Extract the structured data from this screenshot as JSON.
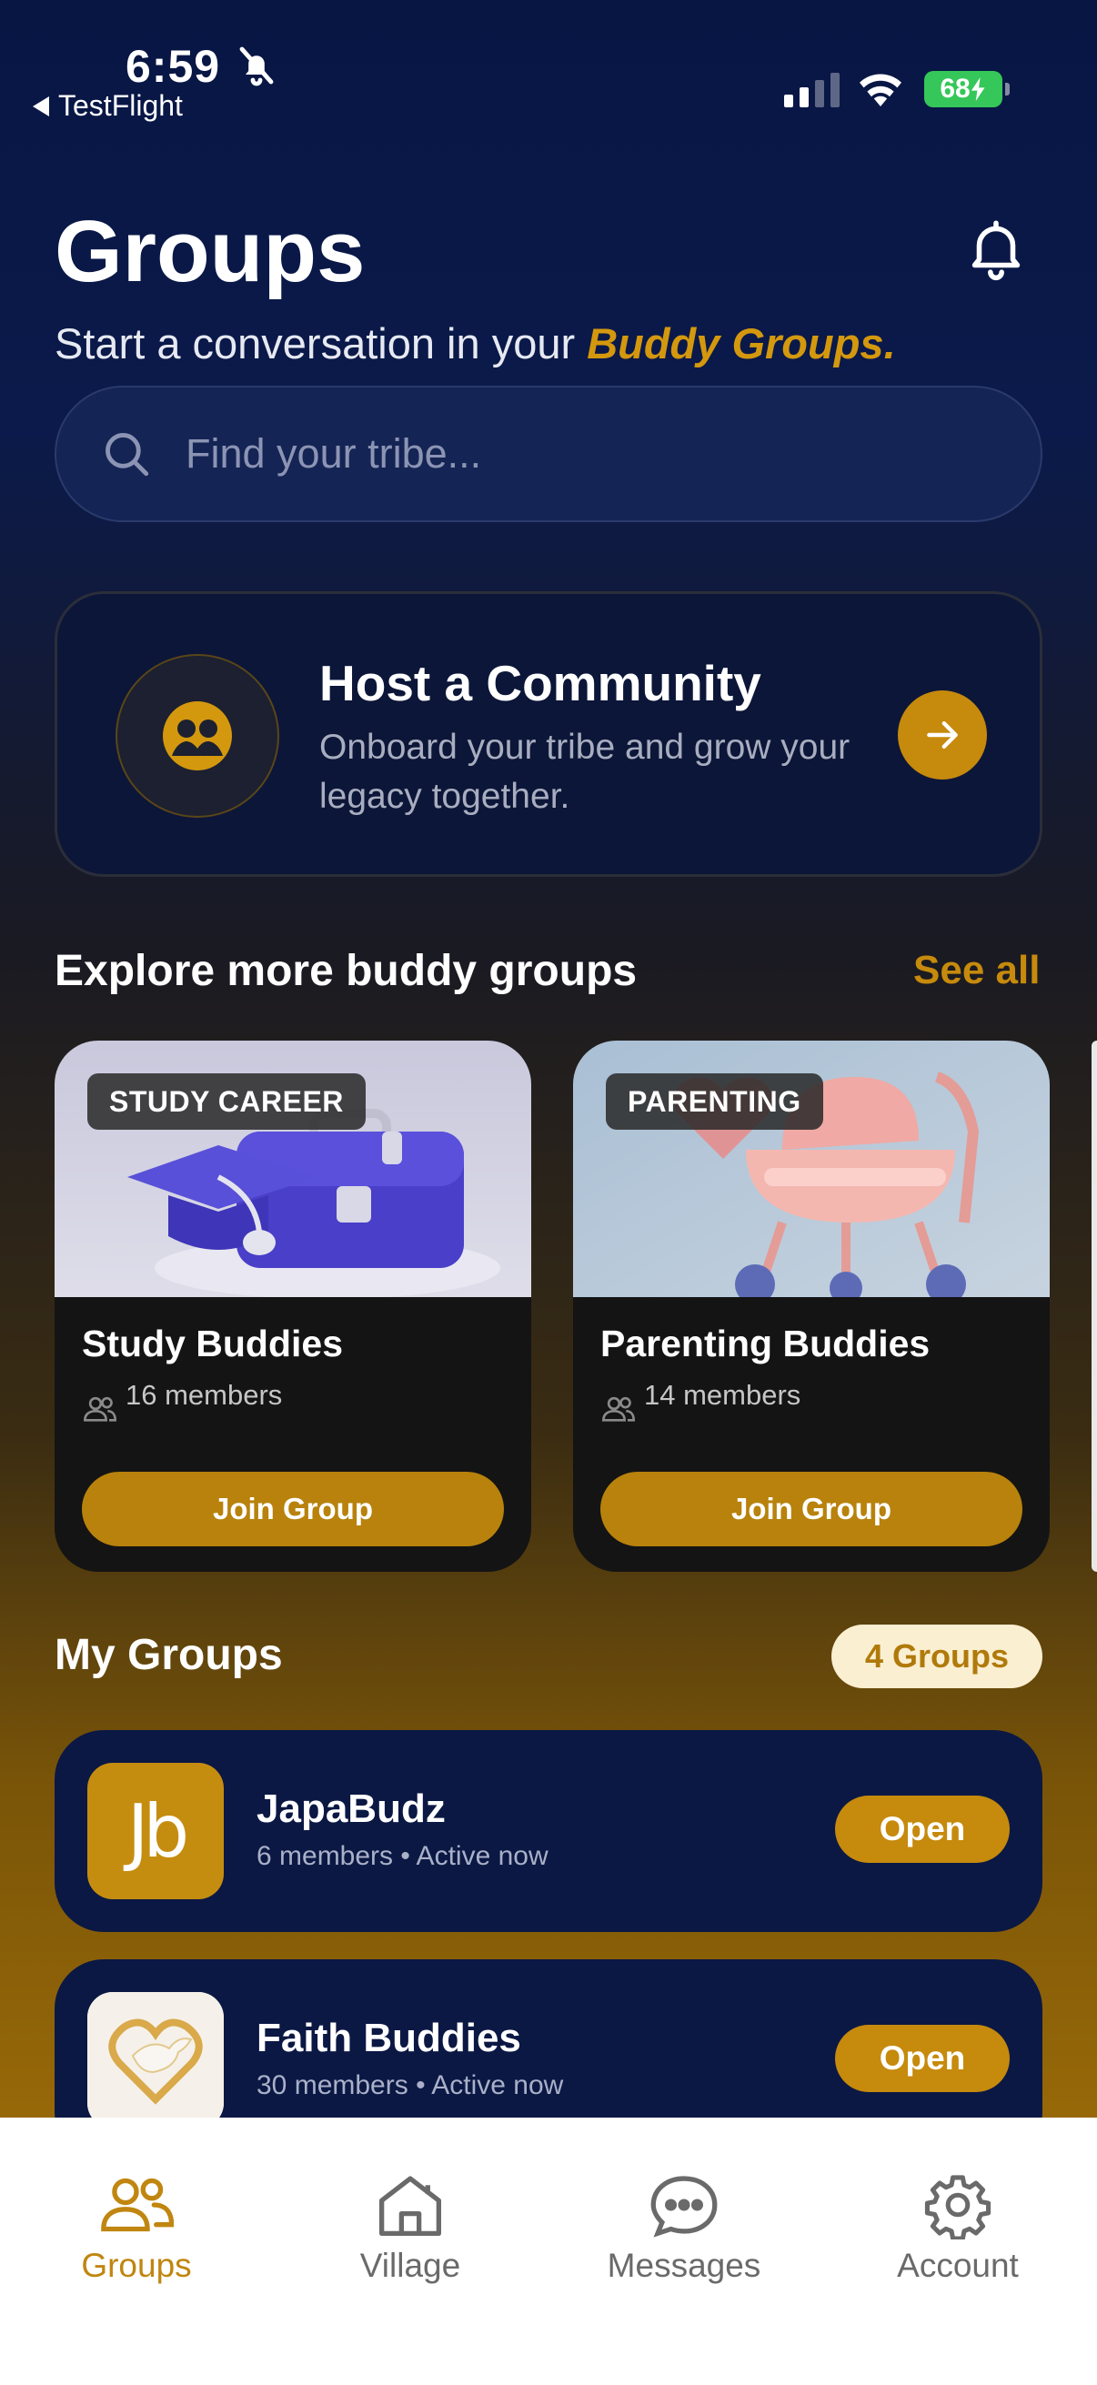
{
  "status_bar": {
    "time": "6:59",
    "back_app": "TestFlight",
    "battery": "68"
  },
  "header": {
    "title": "Groups",
    "subtitle_prefix": "Start a conversation in your ",
    "subtitle_highlight": "Buddy Groups."
  },
  "search": {
    "placeholder": "Find your tribe..."
  },
  "host_card": {
    "title": "Host a Community",
    "description": "Onboard your tribe and grow your legacy together."
  },
  "explore": {
    "title": "Explore more buddy groups",
    "see_all": "See all",
    "cards": [
      {
        "tag": "STUDY CAREER",
        "name": "Study Buddies",
        "members": "16 members",
        "button": "Join Group"
      },
      {
        "tag": "PARENTING",
        "name": "Parenting Buddies",
        "members": "14 members",
        "button": "Join Group"
      }
    ]
  },
  "my_groups": {
    "title": "My Groups",
    "count": "4 Groups",
    "items": [
      {
        "avatar_text": "Jb",
        "name": "JapaBudz",
        "meta": "6 members • Active now",
        "button": "Open"
      },
      {
        "name": "Faith Buddies",
        "meta": "30 members • Active now",
        "button": "Open"
      }
    ]
  },
  "tabbar": {
    "items": [
      {
        "label": "Groups",
        "icon": "groups-icon"
      },
      {
        "label": "Village",
        "icon": "house-icon"
      },
      {
        "label": "Messages",
        "icon": "chat-bubble-icon"
      },
      {
        "label": "Account",
        "icon": "gear-icon"
      }
    ]
  },
  "colors": {
    "accent": "#c68a0c",
    "background_top": "#081644",
    "card_dark": "#0b1844",
    "active_tab": "#c08610"
  }
}
